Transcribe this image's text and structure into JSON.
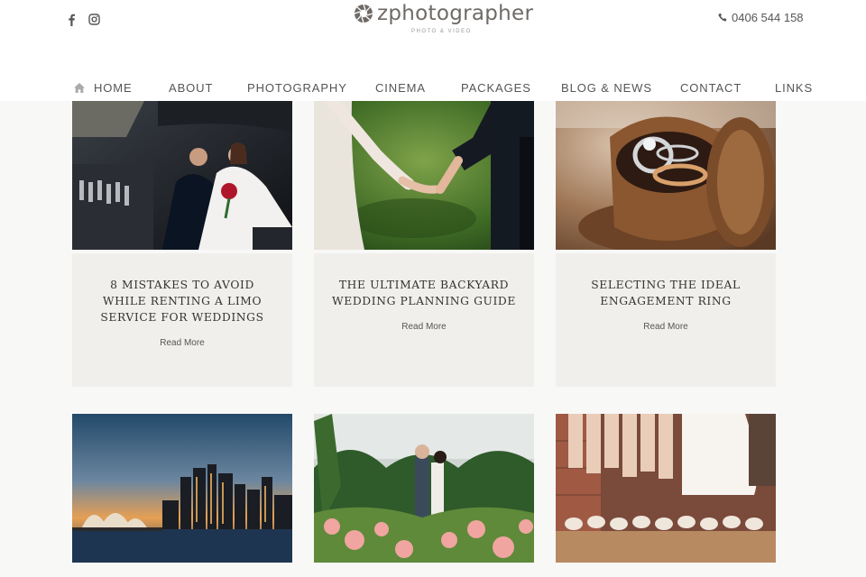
{
  "header": {
    "social": [
      {
        "icon": "facebook-icon"
      },
      {
        "icon": "instagram-icon"
      }
    ],
    "logo": {
      "name": "zphotographer",
      "tagline": "PHOTO & VIDEO"
    },
    "phone": "0406 544 158"
  },
  "nav": {
    "items": [
      {
        "label": "HOME",
        "icon": "home-icon"
      },
      {
        "label": "ABOUT"
      },
      {
        "label": "PHOTOGRAPHY"
      },
      {
        "label": "CINEMA"
      },
      {
        "label": "PACKAGES"
      },
      {
        "label": "BLOG & NEWS"
      },
      {
        "label": "CONTACT"
      },
      {
        "label": "LINKS"
      }
    ]
  },
  "posts": [
    {
      "title": "8 MISTAKES TO AVOID WHILE RENTING A LIMO SERVICE FOR WEDDINGS",
      "link": "Read More"
    },
    {
      "title": "THE ULTIMATE BACKYARD WEDDING PLANNING GUIDE",
      "link": "Read More"
    },
    {
      "title": "SELECTING THE IDEAL ENGAGEMENT RING",
      "link": "Read More"
    }
  ],
  "colors": {
    "card_bg": "#f1efec",
    "text": "#333333",
    "logo": "#6f6a66"
  }
}
